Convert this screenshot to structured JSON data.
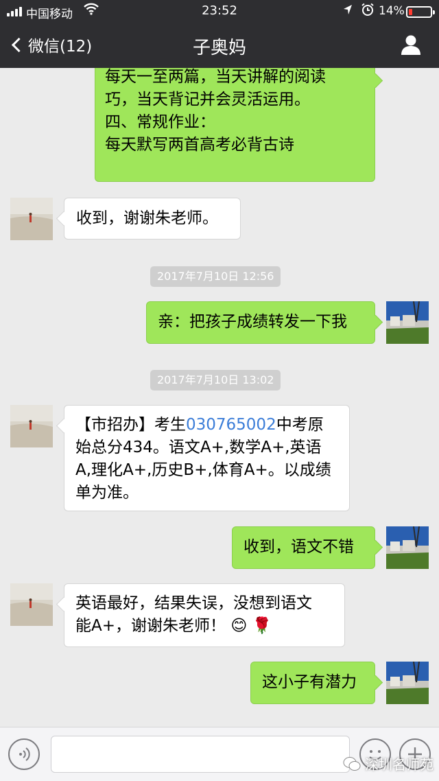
{
  "status_bar": {
    "carrier": "中国移动",
    "time": "23:52",
    "battery": "14%",
    "battery_level": 0.14
  },
  "nav": {
    "back_label": "微信(12)",
    "title": "子奥妈"
  },
  "messages": [
    {
      "side": "right",
      "text": "每天一至两篇，当天讲解的阅读\n巧，当天背记并会灵活运用。\n四、常规作业：\n每天默写两首高考必背古诗"
    },
    {
      "side": "left",
      "text": "收到，谢谢朱老师。"
    },
    {
      "timestamp": "2017年7月10日 12:56"
    },
    {
      "side": "right",
      "text": "亲：把孩子成绩转发一下我"
    },
    {
      "timestamp": "2017年7月10日 13:02"
    },
    {
      "side": "left",
      "text_before": "【市招办】考生",
      "link": "030765002",
      "text_after": "中考原\n始总分434。语文A+,数学A+,英语\nA,理化A+,历史B+,体育A+。以成绩\n单为准。"
    },
    {
      "side": "right",
      "text": "收到，语文不错"
    },
    {
      "side": "left",
      "text": "英语最好，结果失误，没想到语文\n能A+，谢谢朱老师！",
      "emoji": "😊 🌹"
    },
    {
      "side": "right",
      "text": "这小子有潜力"
    }
  ],
  "input": {
    "voice_icon": "voice-icon",
    "emoji_icon": "emoji-icon",
    "more_icon": "plus-icon"
  },
  "watermark": "深圳名师苑",
  "colors": {
    "header_bg": "#2e2e31",
    "chat_bg": "#ebebeb",
    "bubble_sent": "#9fe65a",
    "bubble_received": "#ffffff",
    "link": "#3b7dd8"
  }
}
